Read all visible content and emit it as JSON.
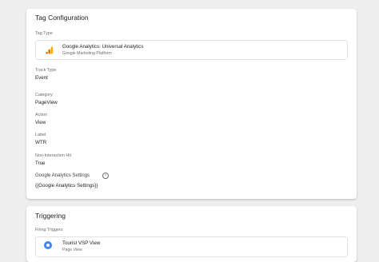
{
  "config": {
    "title": "Tag Configuration",
    "tag_type_label": "Tag Type",
    "tag": {
      "name": "Google Analytics: Universal Analytics",
      "provider": "Google Marketing Platform",
      "icon": "google-analytics-icon",
      "icon_color": "#f9ab00"
    },
    "fields": [
      {
        "label": "Track Type",
        "value": "Event"
      },
      {
        "label": "Category",
        "value": "PageView"
      },
      {
        "label": "Action",
        "value": "View"
      },
      {
        "label": "Label",
        "value": "WTR"
      },
      {
        "label": "Non-Interaction Hit",
        "value": "True"
      },
      {
        "label": "Google Analytics Settings",
        "value": "{{Google Analytics Settings}}"
      }
    ]
  },
  "triggering": {
    "title": "Triggering",
    "firing_label": "Firing Triggers",
    "trigger": {
      "name": "Tourist VSP View",
      "type": "Page View",
      "icon": "eye-icon",
      "icon_color": "#4285f4"
    }
  }
}
